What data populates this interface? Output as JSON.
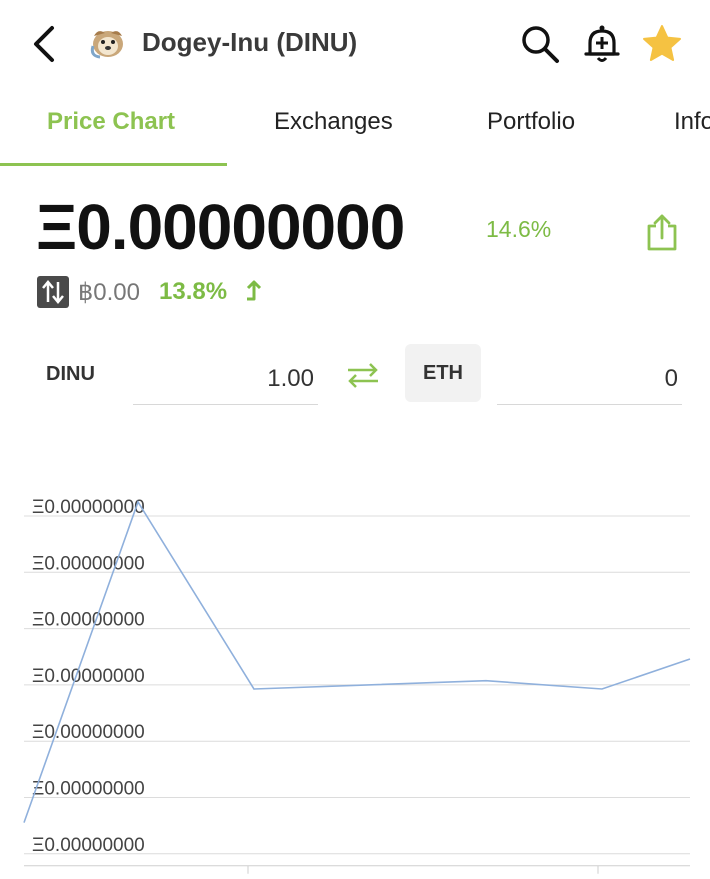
{
  "header": {
    "title": "Dogey-Inu (DINU)"
  },
  "tabs": [
    {
      "label": "Price Chart",
      "active": true
    },
    {
      "label": "Exchanges",
      "active": false
    },
    {
      "label": "Portfolio",
      "active": false
    },
    {
      "label": "Info",
      "active": false
    }
  ],
  "price": {
    "main": "Ξ0.00000000",
    "change": "14.6%",
    "btc_price": "฿0.00",
    "btc_change": "13.8%"
  },
  "converter": {
    "from_symbol": "DINU",
    "from_value": "1.00",
    "to_symbol": "ETH",
    "to_value": "0"
  },
  "colors": {
    "accent": "#8dc351",
    "positive": "#7dbb45",
    "line": "#8fb0dc"
  },
  "chart_data": {
    "type": "line",
    "y_tick_labels": [
      "Ξ0.00000000",
      "Ξ0.00000000",
      "Ξ0.00000000",
      "Ξ0.00000000",
      "Ξ0.00000000",
      "Ξ0.00000000",
      "Ξ0.00000000"
    ],
    "grid": true,
    "series": [
      {
        "relative_values": [
          0.04,
          1.0,
          0.44,
          0.465,
          0.44,
          0.53
        ]
      }
    ]
  }
}
